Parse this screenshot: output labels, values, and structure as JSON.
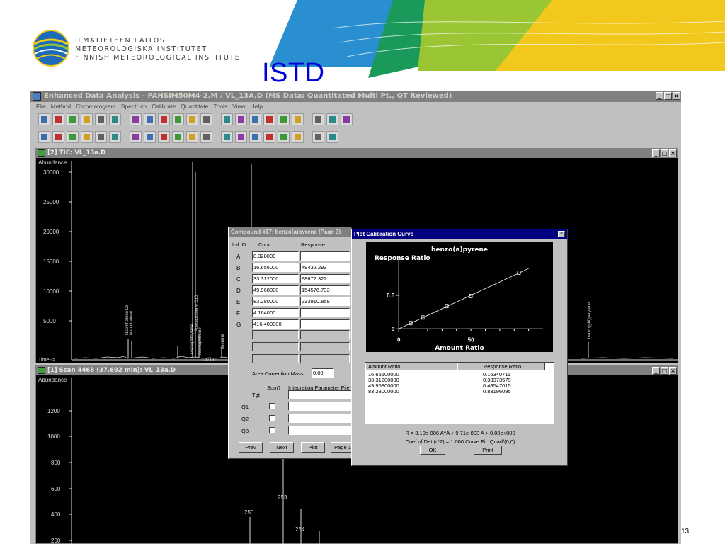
{
  "slide": {
    "institute_lines": [
      "ILMATIETEEN LAITOS",
      "METEOROLOGISKA INSTITUTET",
      "FINNISH METEOROLOGICAL INSTITUTE"
    ],
    "title": "ISTD",
    "page_number": "13",
    "colors": {
      "title": "#0000d8",
      "stripe_blue": "#2a8fd0",
      "stripe_green": "#9ac634",
      "stripe_yellow": "#f2c81c"
    }
  },
  "app": {
    "title": "Enhanced Data Analysis - PAHSIM50M4-2.M / VL_13A.D   (MS Data: Quantitated Multi Pt., QT Reviewed)",
    "window_buttons": [
      "_",
      "□",
      "×"
    ],
    "menu": [
      "File",
      "Method",
      "Chromatogram",
      "Spectrum",
      "Calibrate",
      "Quantitate",
      "Tools",
      "View",
      "Help"
    ],
    "toolbar1_icons": [
      "report-icon",
      "open-icon",
      "save-icon",
      "camera-icon",
      "print-icon",
      "copy-icon",
      "chart-icon",
      "go-icon",
      "stop-icon",
      "window-icon",
      "color-icon",
      "tile-icon",
      "list-icon",
      "monitor-icon",
      "graph-icon",
      "image-icon",
      "peak-icon",
      "sample-icon",
      "hammer1-icon",
      "hammer2-icon",
      "hammer3-icon"
    ],
    "toolbar2_icons": [
      "chrom-icon",
      "scan-icon",
      "overlay-icon",
      "spectra-icon",
      "flag-icon",
      "integrate-icon",
      "peak2-icon",
      "library-icon",
      "bank-icon",
      "bank2-icon",
      "page-icon",
      "edit-icon",
      "calib-icon",
      "quant-icon",
      "docs-icon",
      "docs2-icon",
      "docs3-icon",
      "report2-icon",
      "report3-icon",
      "help-icon"
    ]
  },
  "tic_window": {
    "title": "[2] TIC: VL_13a.D",
    "y_label": "Abundance",
    "y_ticks": [
      "30000",
      "25000",
      "20000",
      "15000",
      "10000",
      "5000"
    ],
    "x_label": "Time-->",
    "x_tick": "20.00",
    "peak_labels": [
      "Naphthalene D8",
      "Naphthalene",
      "Acenaphthylene",
      "Acenaphthene D10",
      "Acenaphthene",
      "fluorene",
      "benzo(ghi)perylene"
    ]
  },
  "scan_window": {
    "title": "[1] Scan 4468 (37.692 min): VL_13a.D",
    "y_label": "Abundance",
    "y_ticks": [
      "1200",
      "1000",
      "800",
      "600",
      "400",
      "200"
    ],
    "peak_labels": [
      "250",
      "253",
      "254"
    ]
  },
  "compound_dialog": {
    "title": "Compound #17: benzo(a)pyrene (Page 3)",
    "col_lvl": "Lvl ID",
    "col_conc": "Conc",
    "col_resp": "Response",
    "levels": [
      {
        "id": "A",
        "conc": "8.328000",
        "resp": ""
      },
      {
        "id": "B",
        "conc": "16.656000",
        "resp": "49432.293"
      },
      {
        "id": "C",
        "conc": "33.312000",
        "resp": "98672.322"
      },
      {
        "id": "D",
        "conc": "49.968000",
        "resp": "154576.733"
      },
      {
        "id": "E",
        "conc": "83.280000",
        "resp": "233910.859"
      },
      {
        "id": "F",
        "conc": "4.164000",
        "resp": ""
      },
      {
        "id": "G",
        "conc": "416.400000",
        "resp": ""
      }
    ],
    "area_label": "Area Correction Mass:",
    "area_value": "0.00",
    "sum_label": "Sum?",
    "integ_label": "Integration Parameter File",
    "tgt_label": "Tgt",
    "q_labels": [
      "Q1",
      "Q2",
      "Q3"
    ],
    "buttons": [
      "Prev",
      "Next",
      "Plot",
      "Page 1"
    ]
  },
  "calib_dialog": {
    "title": "Plot Calibration Curve",
    "close": "×",
    "chart_title": "benzo(a)pyrene",
    "y_label": "Response Ratio",
    "x_label": "Amount Ratio",
    "y_ticks": [
      "0.5",
      "0"
    ],
    "x_ticks": [
      "0",
      "50"
    ],
    "list_headers": [
      "Amount Ratio",
      "Response Ratio"
    ],
    "rows": [
      {
        "amount": "16.65600000",
        "response": "0.16340711"
      },
      {
        "amount": "33.31200000",
        "response": "0.33373579"
      },
      {
        "amount": "49.96800000",
        "response": "0.48547015"
      },
      {
        "amount": "83.28000000",
        "response": "0.83196095"
      }
    ],
    "equation": "R = 3.19e-006 A^A + 9.71e-003 A + 0.00e+000",
    "coef": "Coef of Det (r^2) = 1.000   Curve Fit: Quad/(0,0)",
    "ok": "OK",
    "print": "Print"
  },
  "chart_data": {
    "type": "scatter",
    "title": "benzo(a)pyrene",
    "xlabel": "Amount Ratio",
    "ylabel": "Response Ratio",
    "series": [
      {
        "name": "",
        "x": [
          8.3,
          16.656,
          33.312,
          49.968,
          83.28
        ],
        "y": [
          0.08,
          0.1634,
          0.3337,
          0.4855,
          0.832
        ]
      }
    ],
    "fit_line": {
      "x": [
        0,
        90
      ],
      "y": [
        0,
        0.9
      ]
    },
    "xlim": [
      -5,
      100
    ],
    "ylim": [
      -0.05,
      1.05
    ],
    "grid": false
  }
}
